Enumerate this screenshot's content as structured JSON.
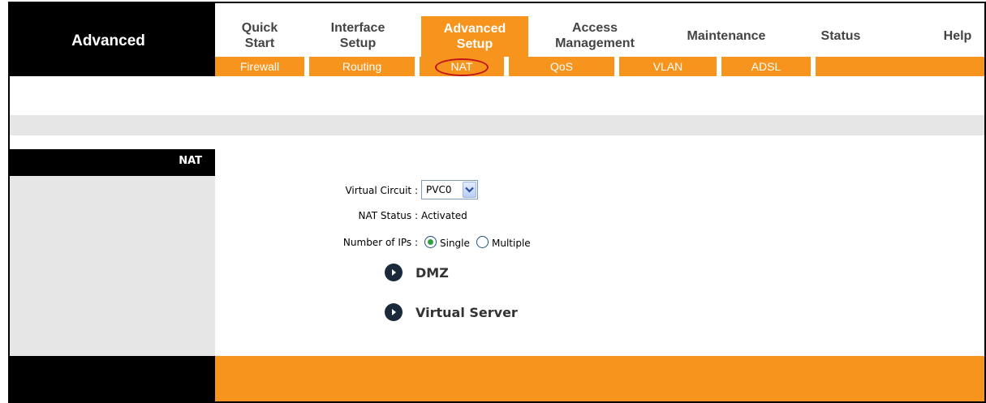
{
  "brand": "Advanced",
  "main_tabs": [
    {
      "label_line1": "Quick",
      "label_line2": "Start"
    },
    {
      "label_line1": "Interface",
      "label_line2": "Setup"
    },
    {
      "label_line1": "Advanced",
      "label_line2": "Setup"
    },
    {
      "label_line1": "Access",
      "label_line2": "Management"
    },
    {
      "label_line1": "Maintenance",
      "label_line2": ""
    },
    {
      "label_line1": "Status",
      "label_line2": ""
    },
    {
      "label_line1": "Help",
      "label_line2": ""
    }
  ],
  "active_tab": "Advanced Setup",
  "sub_tabs": [
    "Firewall",
    "Routing",
    "NAT",
    "QoS",
    "VLAN",
    "ADSL"
  ],
  "active_sub_tab": "NAT",
  "section": {
    "title": "NAT"
  },
  "form": {
    "virtual_circuit_label": "Virtual Circuit :",
    "virtual_circuit_value": "PVC0",
    "nat_status_label": "NAT Status :",
    "nat_status_value": "Activated",
    "number_of_ips_label": "Number of IPs :",
    "option_single": "Single",
    "option_multiple": "Multiple",
    "selected_option": "Single"
  },
  "links": [
    {
      "label": "DMZ"
    },
    {
      "label": "Virtual Server"
    }
  ],
  "colors": {
    "accent_orange": "#f7941d",
    "header_black": "#000000",
    "panel_grey": "#e6e6e6",
    "highlight_oval": "#c0141e"
  }
}
